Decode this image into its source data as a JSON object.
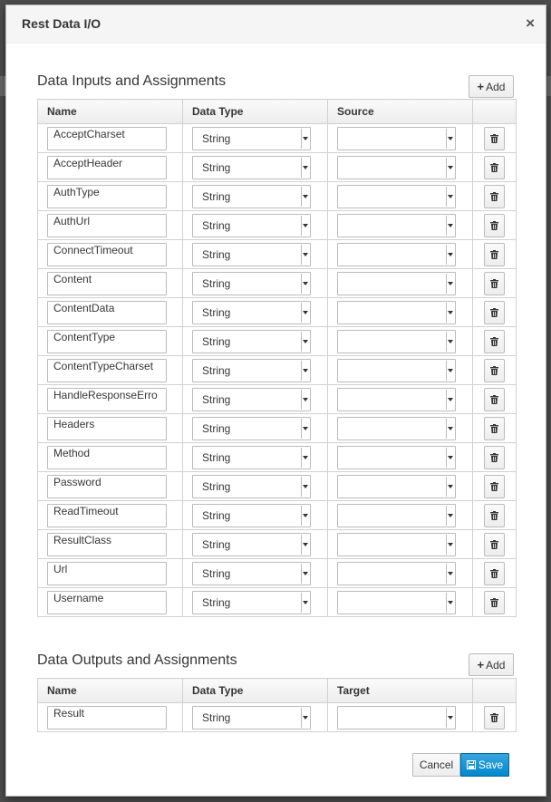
{
  "dialog": {
    "title": "Rest Data I/O",
    "close_label": "×"
  },
  "inputs": {
    "section_title": "Data Inputs and Assignments",
    "add_label": "Add",
    "headers": [
      "Name",
      "Data Type",
      "Source",
      ""
    ],
    "rows": [
      {
        "name": "AcceptCharset",
        "type": "String",
        "source": ""
      },
      {
        "name": "AcceptHeader",
        "type": "String",
        "source": ""
      },
      {
        "name": "AuthType",
        "type": "String",
        "source": ""
      },
      {
        "name": "AuthUrl",
        "type": "String",
        "source": ""
      },
      {
        "name": "ConnectTimeout",
        "type": "String",
        "source": ""
      },
      {
        "name": "Content",
        "type": "String",
        "source": ""
      },
      {
        "name": "ContentData",
        "type": "String",
        "source": ""
      },
      {
        "name": "ContentType",
        "type": "String",
        "source": ""
      },
      {
        "name": "ContentTypeCharset",
        "type": "String",
        "source": ""
      },
      {
        "name": "HandleResponseErro",
        "type": "String",
        "source": ""
      },
      {
        "name": "Headers",
        "type": "String",
        "source": ""
      },
      {
        "name": "Method",
        "type": "String",
        "source": ""
      },
      {
        "name": "Password",
        "type": "String",
        "source": ""
      },
      {
        "name": "ReadTimeout",
        "type": "String",
        "source": ""
      },
      {
        "name": "ResultClass",
        "type": "String",
        "source": ""
      },
      {
        "name": "Url",
        "type": "String",
        "source": ""
      },
      {
        "name": "Username",
        "type": "String",
        "source": ""
      }
    ]
  },
  "outputs": {
    "section_title": "Data Outputs and Assignments",
    "add_label": "Add",
    "headers": [
      "Name",
      "Data Type",
      "Target",
      ""
    ],
    "rows": [
      {
        "name": "Result",
        "type": "String",
        "target": ""
      }
    ]
  },
  "footer": {
    "cancel_label": "Cancel",
    "save_label": "Save"
  },
  "colors": {
    "primary": "#0088ce",
    "header_bg": "#f5f5f5",
    "border": "#d1d1d1"
  },
  "icons": {
    "add": "plus-icon",
    "delete": "trash-icon",
    "save": "floppy-disk-icon",
    "close": "close-icon",
    "dropdown": "caret-down-icon"
  }
}
